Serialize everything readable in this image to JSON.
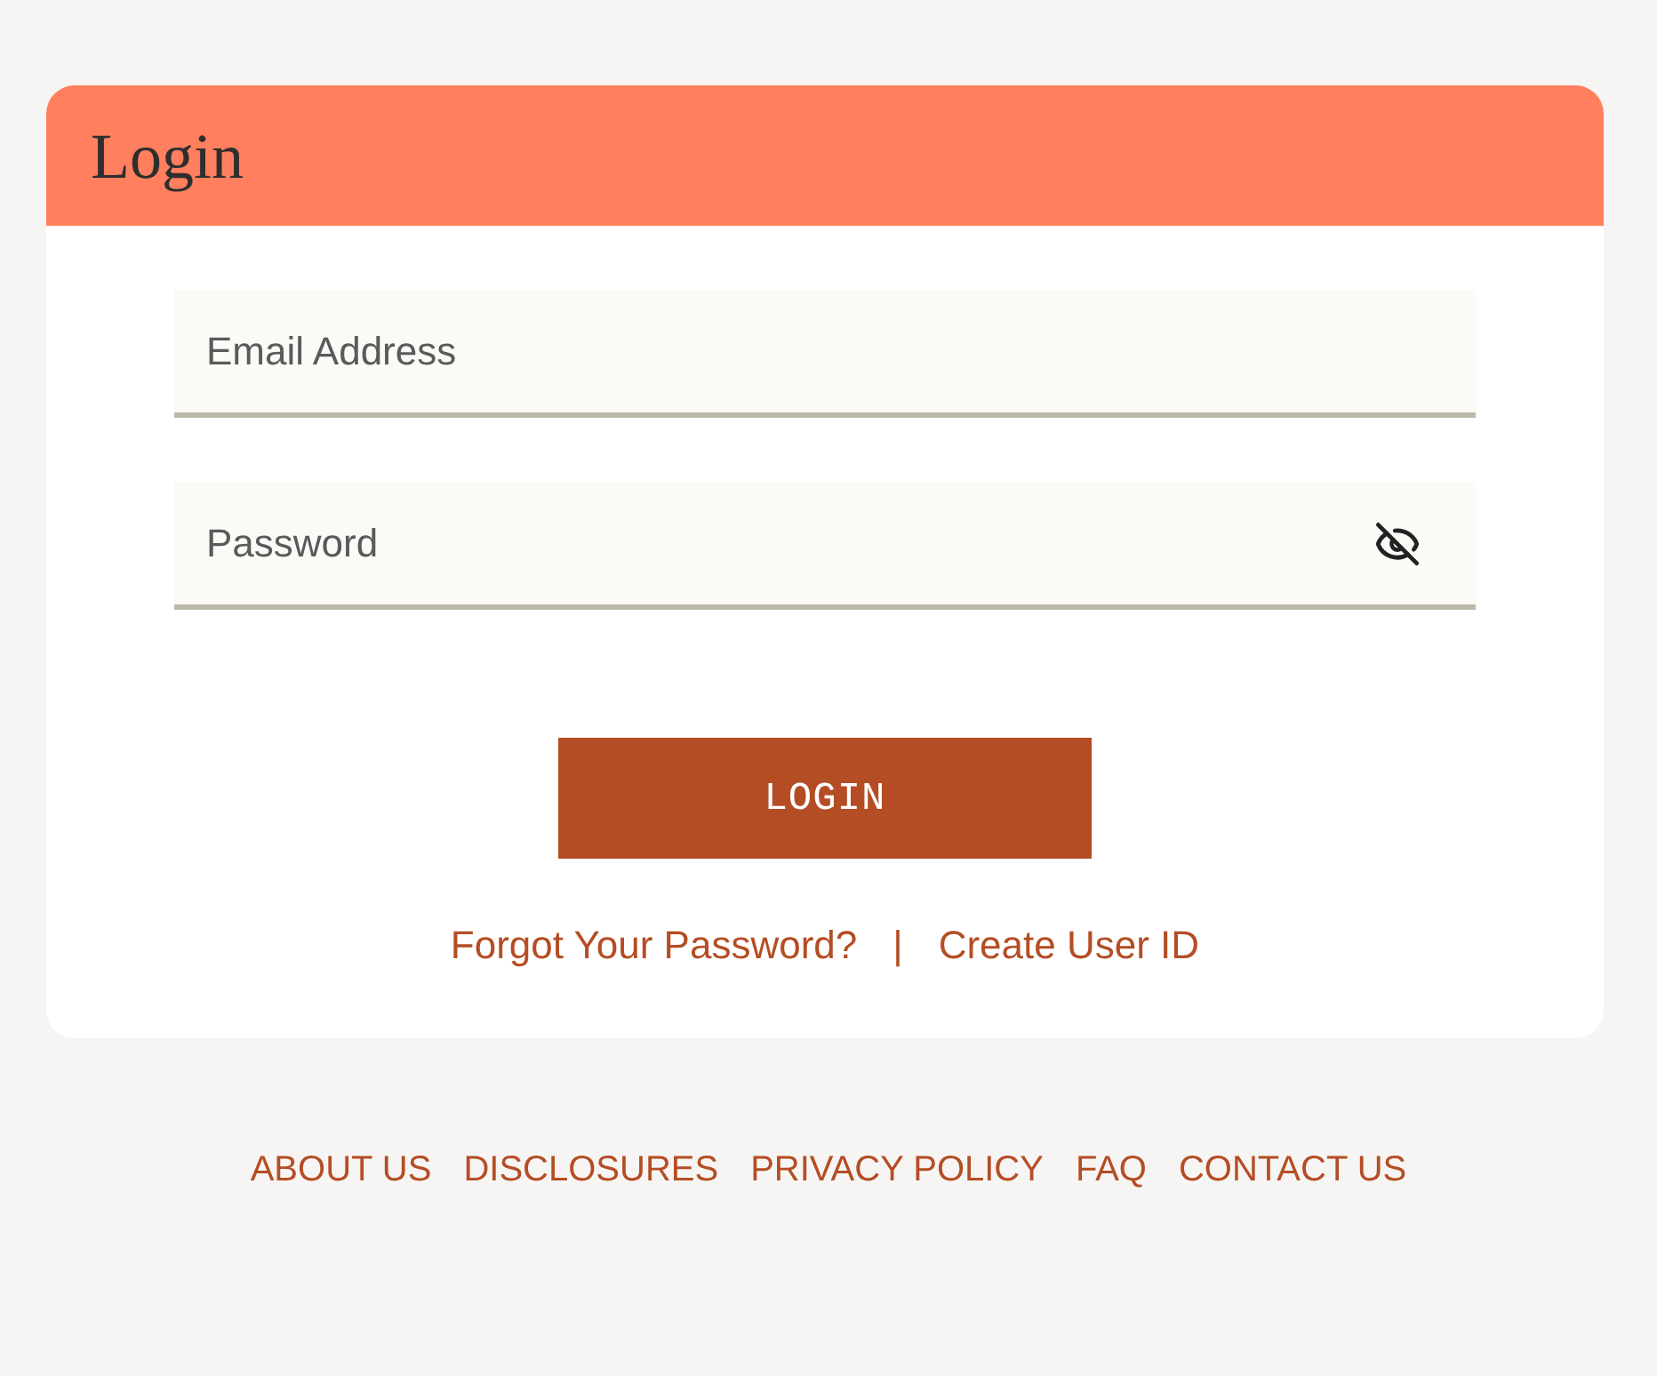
{
  "header": {
    "title": "Login"
  },
  "form": {
    "fields": [
      {
        "kind": "email",
        "placeholder": "Email Address"
      },
      {
        "kind": "password",
        "placeholder": "Password"
      }
    ],
    "submit": "LOGIN",
    "links": [
      "Forgot Your Password?",
      "Create User ID"
    ],
    "link_separator": "|"
  },
  "footer": {
    "links": [
      "ABOUT US",
      "DISCLOSURES",
      "PRIVACY POLICY",
      "FAQ",
      "CONTACT US"
    ]
  }
}
